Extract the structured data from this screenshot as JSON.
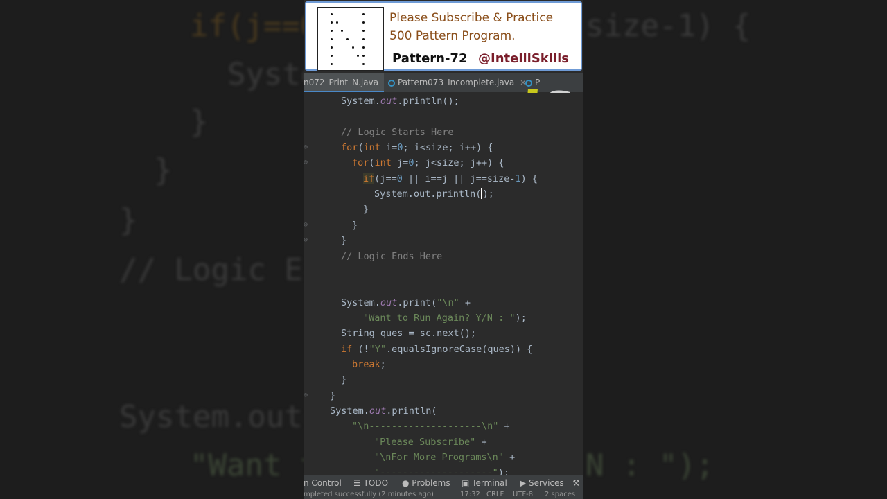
{
  "banner": {
    "line1": "Please Subscribe & Practice",
    "line2": "500 Pattern Program.",
    "pattern_label": "Pattern-72",
    "handle": "@IntelliSkills"
  },
  "tabs": [
    {
      "label": "n072_Print_N.java",
      "active": true
    },
    {
      "label": "Pattern073_Incomplete.java",
      "active": false
    },
    {
      "label": "P",
      "active": false
    }
  ],
  "code_lines": [
    "System.out.println();",
    "",
    "// Logic Starts Here",
    "for(int i=0; i<size; i++) {",
    "for(int j=0; j<size; j++) {",
    "if(j==0 || i==j || j==size-1) {",
    "System.out.println();",
    "}",
    "}",
    "}",
    "// Logic Ends Here",
    "",
    "",
    "System.out.print(\"\\n\" +",
    "\"Want to Run Again? Y/N : \");",
    "String ques = sc.next();",
    "if (!\"Y\".equalsIgnoreCase(ques)) {",
    "break;",
    "}",
    "}",
    "System.out.println(",
    "\"\\n--------------------\\n\" +",
    "\"Please Subscribe\" +",
    "\"\\nFor More Programs\\n\" +",
    "\"--------------------\");"
  ],
  "toolbar": {
    "version_control": "n Control",
    "todo": "TODO",
    "problems": "Problems",
    "terminal": "Terminal",
    "services": "Services"
  },
  "statusbar": {
    "message": "mpleted successfully (2 minutes ago)",
    "position": "17:32",
    "line_sep": "CRLF",
    "encoding": "UTF-8",
    "indent": "2 spaces"
  },
  "background": {
    "line1": "if(j==0",
    "line1b": "size-1) {",
    "line2": "Syste",
    "line3": "}",
    "line4": "}",
    "line5": "}",
    "line6": "// Logic Er",
    "line7": "System.out",
    "line8": "\"Want t",
    "line8b": "N : \");"
  },
  "colors": {
    "keyword": "#cc7832",
    "field": "#9876aa",
    "comment": "#808080",
    "string": "#6a8759",
    "number": "#6897bb",
    "editor_bg": "#2b2b2b"
  }
}
